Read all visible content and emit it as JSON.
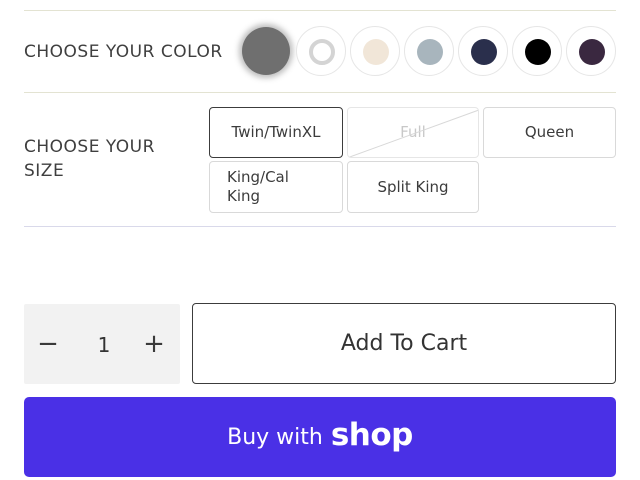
{
  "color_section": {
    "label": "CHOOSE YOUR COLOR",
    "swatches": [
      {
        "name": "selected-grey",
        "color": "#6f6f6f",
        "selected": true
      },
      {
        "name": "white",
        "color": "#ffffff",
        "ring": "#d4d4d4"
      },
      {
        "name": "cream",
        "color": "#f1e6d8"
      },
      {
        "name": "blue-grey",
        "color": "#a8b5bd"
      },
      {
        "name": "navy",
        "color": "#2a2f4c"
      },
      {
        "name": "black",
        "color": "#000000"
      },
      {
        "name": "plum",
        "color": "#3a2840"
      }
    ]
  },
  "size_section": {
    "label": "CHOOSE YOUR SIZE",
    "options": [
      {
        "label": "Twin/TwinXL",
        "state": "selected"
      },
      {
        "label": "Full",
        "state": "unavailable"
      },
      {
        "label": "Queen",
        "state": "available"
      },
      {
        "label": "King/Cal King",
        "state": "available"
      },
      {
        "label": "Split King",
        "state": "available"
      }
    ]
  },
  "quantity": {
    "minus": "−",
    "value": "1",
    "plus": "+"
  },
  "add_to_cart": {
    "label": "Add To Cart"
  },
  "buy_with_shop": {
    "label": "Buy with",
    "logo_text": "shop",
    "color": "#4a30e6"
  }
}
